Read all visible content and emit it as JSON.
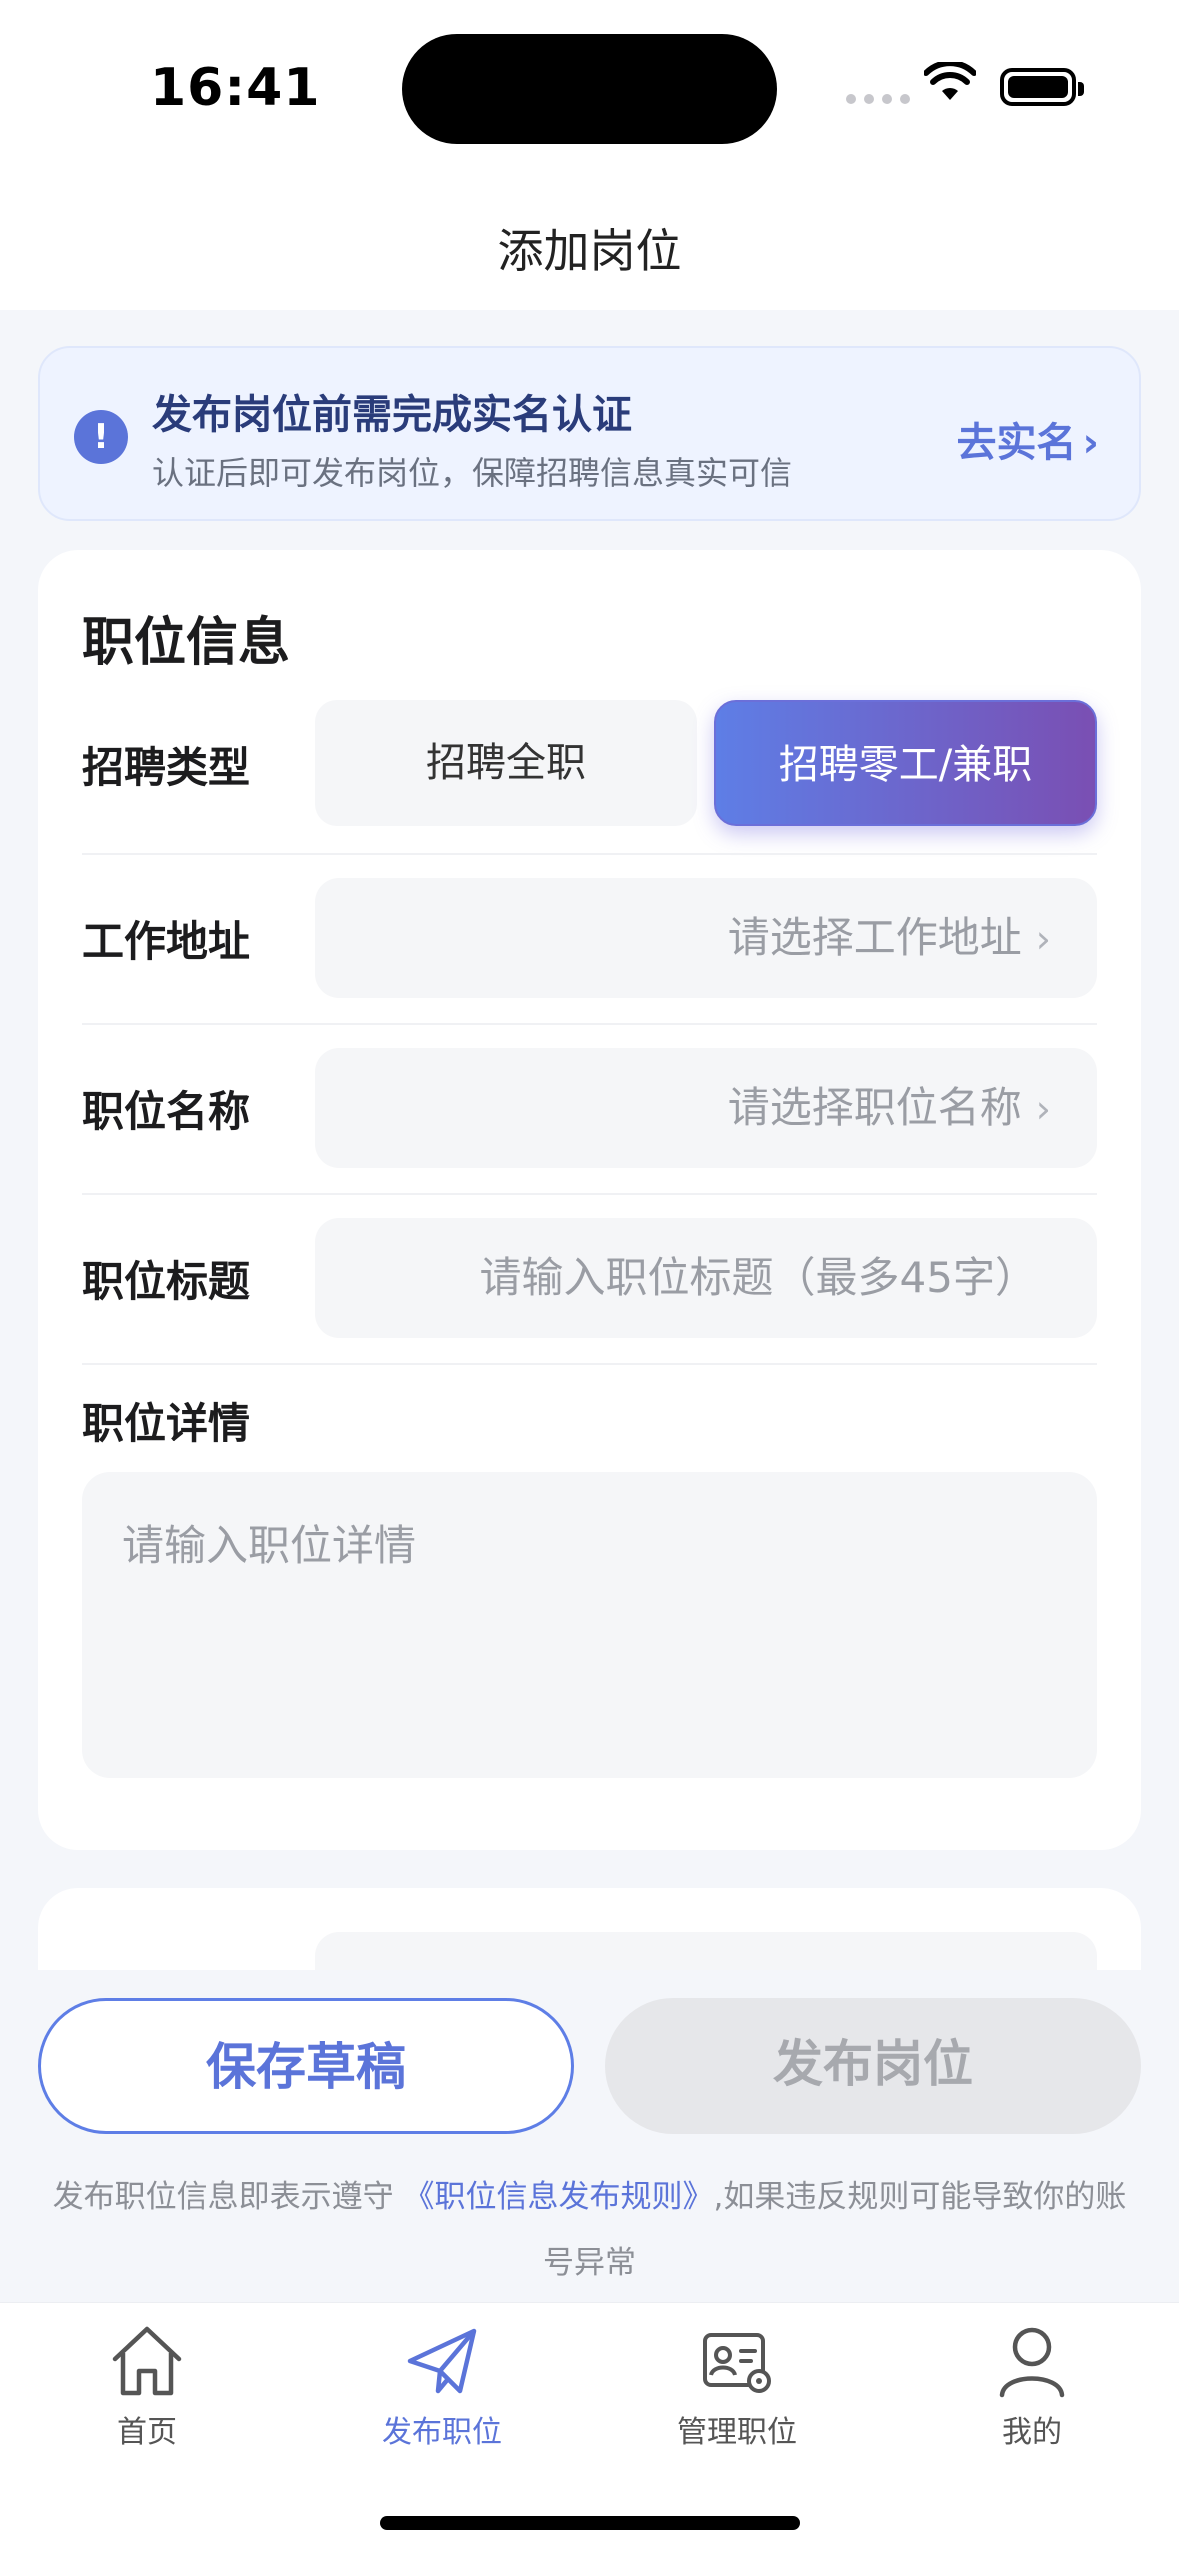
{
  "status_bar": {
    "time": "16:41"
  },
  "nav": {
    "title": "添加岗位"
  },
  "notice": {
    "icon": "exclamation-icon",
    "title": "发布岗位前需完成实名认证",
    "subtitle": "认证后即可发布岗位，保障招聘信息真实可信",
    "link": "去实名",
    "link_chevron": "›"
  },
  "form": {
    "section_title": "职位信息",
    "recruit_type": {
      "label": "招聘类型",
      "options": [
        "招聘全职",
        "招聘零工/兼职"
      ],
      "selected": "招聘零工/兼职"
    },
    "address": {
      "label": "工作地址",
      "placeholder": "请选择工作地址"
    },
    "position_name": {
      "label": "职位名称",
      "placeholder": "请选择职位名称"
    },
    "position_title": {
      "label": "职位标题",
      "placeholder": "请输入职位标题（最多45字）"
    },
    "details": {
      "label": "职位详情",
      "placeholder": "请输入职位详情"
    },
    "chevron": "›"
  },
  "actions": {
    "save_draft": "保存草稿",
    "publish": "发布岗位",
    "rule_prefix": "发布职位信息即表示遵守",
    "rule_link": "《职位信息发布规则》",
    "rule_suffix": ",如果违反规则可能导致你的账号异常"
  },
  "tabbar": {
    "items": [
      {
        "label": "首页",
        "icon": "home-icon"
      },
      {
        "label": "发布职位",
        "icon": "paper-plane-icon"
      },
      {
        "label": "管理职位",
        "icon": "id-card-gear-icon"
      },
      {
        "label": "我的",
        "icon": "user-icon"
      }
    ],
    "active_index": 1
  },
  "colors": {
    "accent": "#5b74d9",
    "gradient_start": "#5e7ee6",
    "gradient_end": "#7a4fb3"
  }
}
